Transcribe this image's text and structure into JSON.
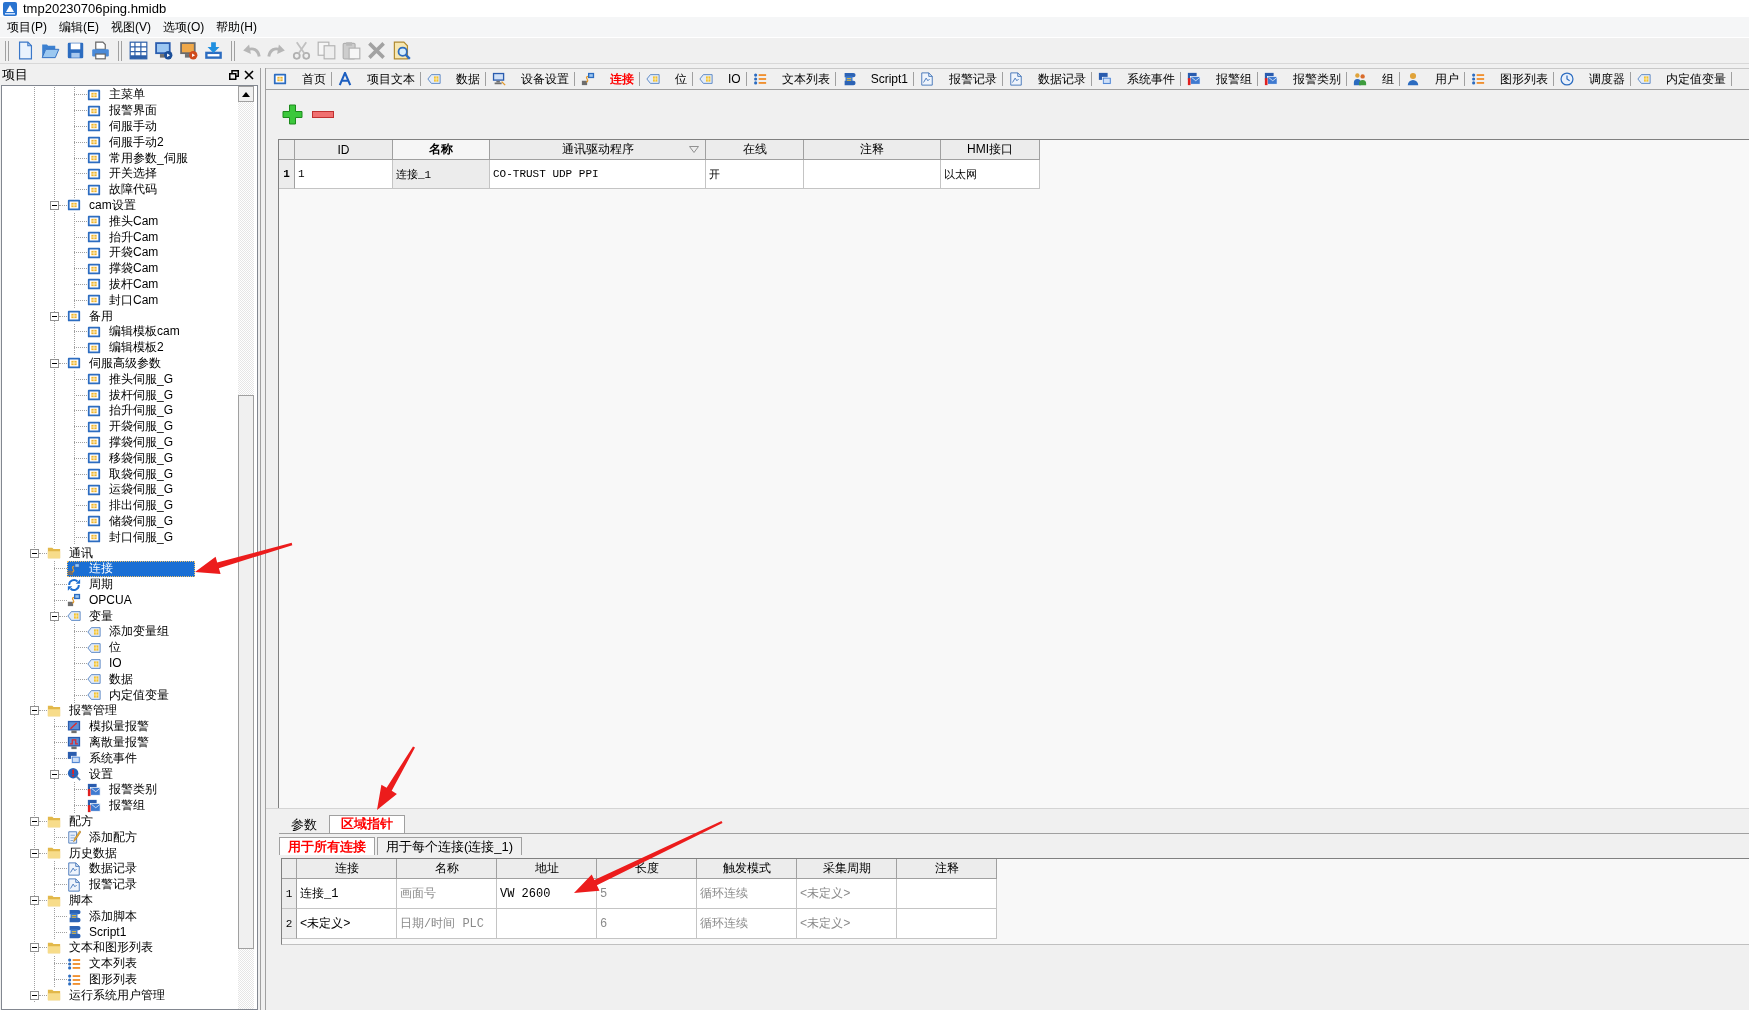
{
  "window": {
    "title": "tmp20230706ping.hmidb"
  },
  "menu_bar": [
    "项目(P)",
    "编辑(E)",
    "视图(V)",
    "选项(O)",
    "帮助(H)"
  ],
  "toolbar": {
    "groups": [
      [
        {
          "kind": "new",
          "disabled": false
        },
        {
          "kind": "open",
          "disabled": false
        },
        {
          "kind": "save",
          "disabled": false
        },
        {
          "kind": "print",
          "disabled": false
        }
      ],
      [
        {
          "kind": "compile",
          "disabled": false
        },
        {
          "kind": "simulate",
          "disabled": false
        },
        {
          "kind": "simulate-online",
          "disabled": false
        },
        {
          "kind": "download",
          "disabled": false
        }
      ],
      [
        {
          "kind": "undo",
          "disabled": true
        },
        {
          "kind": "redo",
          "disabled": true
        },
        {
          "kind": "cut",
          "disabled": true
        },
        {
          "kind": "copy",
          "disabled": true
        },
        {
          "kind": "paste",
          "disabled": true
        },
        {
          "kind": "delete",
          "disabled": true
        },
        {
          "kind": "find",
          "disabled": false
        }
      ]
    ]
  },
  "project_panel": {
    "title": "项目",
    "tree": [
      {
        "children": [
          {
            "children": [
              {
                "label": "主菜单",
                "kind": "screen",
                "selected": false
              },
              {
                "label": "报警界面",
                "kind": "screen",
                "selected": false
              },
              {
                "label": "伺服手动",
                "kind": "screen",
                "selected": false
              },
              {
                "label": "伺服手动2",
                "kind": "screen",
                "selected": false
              },
              {
                "label": "常用参数_伺服",
                "kind": "screen",
                "selected": false
              },
              {
                "label": "开关选择",
                "kind": "screen",
                "selected": false
              },
              {
                "label": "故障代码",
                "kind": "screen",
                "selected": false
              }
            ]
          },
          {
            "label": "cam设置",
            "kind": "screen",
            "expanded": true,
            "selected": false,
            "children": [
              {
                "label": "推头Cam",
                "kind": "screen",
                "selected": false
              },
              {
                "label": "抬升Cam",
                "kind": "screen",
                "selected": false
              },
              {
                "label": "开袋Cam",
                "kind": "screen",
                "selected": false
              },
              {
                "label": "撑袋Cam",
                "kind": "screen",
                "selected": false
              },
              {
                "label": "拔杆Cam",
                "kind": "screen",
                "selected": false
              },
              {
                "label": "封口Cam",
                "kind": "screen",
                "selected": false
              }
            ]
          },
          {
            "label": "备用",
            "kind": "screen",
            "expanded": true,
            "selected": false,
            "children": [
              {
                "label": "编辑模板cam",
                "kind": "screen",
                "selected": false
              },
              {
                "label": "编辑模板2",
                "kind": "screen",
                "selected": false
              }
            ]
          },
          {
            "label": "伺服高级参数",
            "kind": "screen",
            "expanded": true,
            "selected": false,
            "children": [
              {
                "label": "推头伺服_G",
                "kind": "screen",
                "selected": false
              },
              {
                "label": "拔杆伺服_G",
                "kind": "screen",
                "selected": false
              },
              {
                "label": "抬升伺服_G",
                "kind": "screen",
                "selected": false
              },
              {
                "label": "开袋伺服_G",
                "kind": "screen",
                "selected": false
              },
              {
                "label": "撑袋伺服_G",
                "kind": "screen",
                "selected": false
              },
              {
                "label": "移袋伺服_G",
                "kind": "screen",
                "selected": false
              },
              {
                "label": "取袋伺服_G",
                "kind": "screen",
                "selected": false
              },
              {
                "label": "运袋伺服_G",
                "kind": "screen",
                "selected": false
              },
              {
                "label": "排出伺服_G",
                "kind": "screen",
                "selected": false
              },
              {
                "label": "储袋伺服_G",
                "kind": "screen",
                "selected": false
              },
              {
                "label": "封口伺服_G",
                "kind": "screen",
                "selected": false
              }
            ]
          }
        ]
      },
      {
        "label": "通讯",
        "kind": "folder",
        "expanded": true,
        "selected": false,
        "children": [
          {
            "label": "连接",
            "kind": "connection",
            "selected": true
          },
          {
            "label": "周期",
            "kind": "cycle",
            "selected": false
          },
          {
            "label": "OPCUA",
            "kind": "connection",
            "selected": false
          },
          {
            "label": "变量",
            "kind": "variable",
            "expanded": true,
            "selected": false,
            "children": [
              {
                "label": "添加变量组",
                "kind": "variable",
                "selected": false
              },
              {
                "label": "位",
                "kind": "variable",
                "selected": false
              },
              {
                "label": "IO",
                "kind": "variable",
                "selected": false
              },
              {
                "label": "数据",
                "kind": "variable",
                "selected": false
              },
              {
                "label": "内定值变量",
                "kind": "variable",
                "selected": false
              }
            ]
          }
        ]
      },
      {
        "label": "报警管理",
        "kind": "folder",
        "expanded": true,
        "selected": false,
        "children": [
          {
            "label": "模拟量报警",
            "kind": "analog-alarm",
            "selected": false
          },
          {
            "label": "离散量报警",
            "kind": "discrete-alarm",
            "selected": false
          },
          {
            "label": "系统事件",
            "kind": "event",
            "selected": false
          },
          {
            "label": "设置",
            "kind": "alarm-settings",
            "expanded": true,
            "selected": false,
            "children": [
              {
                "label": "报警类别",
                "kind": "alarm-class",
                "selected": false
              },
              {
                "label": "报警组",
                "kind": "alarm-class",
                "selected": false
              }
            ]
          }
        ]
      },
      {
        "label": "配方",
        "kind": "folder",
        "expanded": true,
        "selected": false,
        "children": [
          {
            "label": "添加配方",
            "kind": "recipe",
            "selected": false
          }
        ]
      },
      {
        "label": "历史数据",
        "kind": "folder",
        "expanded": true,
        "selected": false,
        "children": [
          {
            "label": "数据记录",
            "kind": "record",
            "selected": false
          },
          {
            "label": "报警记录",
            "kind": "record",
            "selected": false
          }
        ]
      },
      {
        "label": "脚本",
        "kind": "folder",
        "expanded": true,
        "selected": false,
        "children": [
          {
            "label": "添加脚本",
            "kind": "script",
            "selected": false
          },
          {
            "label": "Script1",
            "kind": "script",
            "selected": false
          }
        ]
      },
      {
        "label": "文本和图形列表",
        "kind": "folder",
        "expanded": true,
        "selected": false,
        "children": [
          {
            "label": "文本列表",
            "kind": "list",
            "selected": false
          },
          {
            "label": "图形列表",
            "kind": "list",
            "selected": false
          }
        ]
      },
      {
        "label": "运行系统用户管理",
        "kind": "folder",
        "expanded": true,
        "selected": false
      }
    ]
  },
  "editor_tabs": [
    {
      "label": "首页",
      "kind": "screen",
      "selected": false
    },
    {
      "label": "项目文本",
      "kind": "text",
      "selected": false
    },
    {
      "label": "数据",
      "kind": "variable",
      "selected": false
    },
    {
      "label": "设备设置",
      "kind": "device",
      "selected": false
    },
    {
      "label": "连接",
      "kind": "connection",
      "selected": true
    },
    {
      "label": "位",
      "kind": "variable",
      "selected": false
    },
    {
      "label": "IO",
      "kind": "variable",
      "selected": false
    },
    {
      "label": "文本列表",
      "kind": "list",
      "selected": false
    },
    {
      "label": "Script1",
      "kind": "script",
      "selected": false
    },
    {
      "label": "报警记录",
      "kind": "record",
      "selected": false
    },
    {
      "label": "数据记录",
      "kind": "record",
      "selected": false
    },
    {
      "label": "系统事件",
      "kind": "event",
      "selected": false
    },
    {
      "label": "报警组",
      "kind": "alarm-class",
      "selected": false
    },
    {
      "label": "报警类别",
      "kind": "alarm-class",
      "selected": false
    },
    {
      "label": "组",
      "kind": "users",
      "selected": false
    },
    {
      "label": "用户",
      "kind": "user",
      "selected": false
    },
    {
      "label": "图形列表",
      "kind": "list",
      "selected": false
    },
    {
      "label": "调度器",
      "kind": "scheduler",
      "selected": false
    },
    {
      "label": "内定值变量",
      "kind": "variable",
      "selected": false
    }
  ],
  "connections_table": {
    "columns": [
      {
        "label": "ID",
        "selected": false,
        "sorted": false
      },
      {
        "label": "名称",
        "selected": true,
        "sorted": false
      },
      {
        "label": "通讯驱动程序",
        "selected": false,
        "sorted": true
      },
      {
        "label": "在线",
        "selected": false,
        "sorted": false
      },
      {
        "label": "注释",
        "selected": false,
        "sorted": false
      },
      {
        "label": "HMI接口",
        "selected": false,
        "sorted": false
      }
    ],
    "rows": [
      {
        "number": "1",
        "cells": [
          "1",
          "连接_1",
          "CO-TRUST UDP PPI",
          "开",
          null,
          "以太网"
        ]
      }
    ]
  },
  "area_pointer_panel": {
    "tabs": [
      {
        "label": "参数",
        "selected": false
      },
      {
        "label": "区域指针",
        "selected": true
      }
    ],
    "subtabs": [
      {
        "label": "用于所有连接",
        "selected": true
      },
      {
        "label": "用于每个连接(连接_1)",
        "selected": false
      }
    ],
    "table": {
      "columns": [
        {
          "label": "连接",
          "disabled": false
        },
        {
          "label": "名称",
          "disabled": true
        },
        {
          "label": "地址",
          "disabled": false
        },
        {
          "label": "长度",
          "disabled": true
        },
        {
          "label": "触发模式",
          "disabled": true
        },
        {
          "label": "采集周期",
          "disabled": true
        },
        {
          "label": "注释"
        }
      ],
      "rows": [
        {
          "number": "1",
          "cells": [
            "连接_1",
            "画面号",
            "VW 2600",
            "5",
            "循环连续",
            "<未定义>",
            null
          ]
        },
        {
          "number": "2",
          "cells": [
            "<未定义>",
            "日期/时间 PLC",
            null,
            "6",
            "循环连续",
            "<未定义>",
            null
          ]
        }
      ]
    }
  },
  "annotations": [
    {
      "kind": "arrow"
    },
    {
      "kind": "arrow"
    },
    {
      "kind": "arrow"
    }
  ]
}
